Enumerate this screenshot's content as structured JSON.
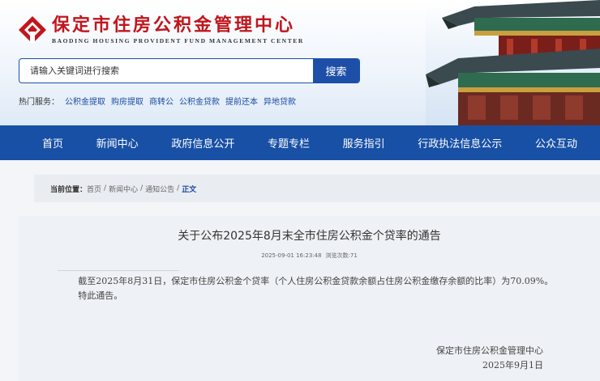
{
  "header": {
    "org_name_cn": "保定市住房公积金管理中心",
    "org_name_en": "BAODING HOUSING PROVIDENT FUND MANAGEMENT CENTER",
    "logo_icon": "building-emblem-icon",
    "banner_image": "pagoda-eaves-illustration",
    "brand_color": "#c0161c"
  },
  "search": {
    "placeholder": "请输入关键词进行搜索",
    "button_label": "搜索",
    "accent": "#1e4fa8"
  },
  "hot_services": {
    "label": "热门服务：",
    "links": [
      "公积金提取",
      "购房提取",
      "商转公",
      "公积金贷款",
      "提前还本",
      "异地贷款"
    ]
  },
  "nav": {
    "items": [
      "首页",
      "新闻中心",
      "政府信息公开",
      "专题专栏",
      "服务指引",
      "行政执法信息公示",
      "公众互动"
    ],
    "background": "#1850a6"
  },
  "breadcrumb": {
    "prefix": "当前位置：",
    "items": [
      "首页",
      "新闻中心",
      "通知公告"
    ],
    "separator": "/",
    "current": "正文"
  },
  "article": {
    "title": "关于公布2025年8月末全市住房公积金个贷率的通告",
    "date": "2025-09-01 16:23:48",
    "views": "浏览次数:71",
    "paragraphs": [
      "截至2025年8月31日，保定市住房公积金个贷率（个人住房公积金贷款余额占住房公积金缴存余额的比率）为70.09%。",
      "特此通告。"
    ],
    "signature": "保定市住房公积金管理中心",
    "sign_date": "2025年9月1日"
  }
}
